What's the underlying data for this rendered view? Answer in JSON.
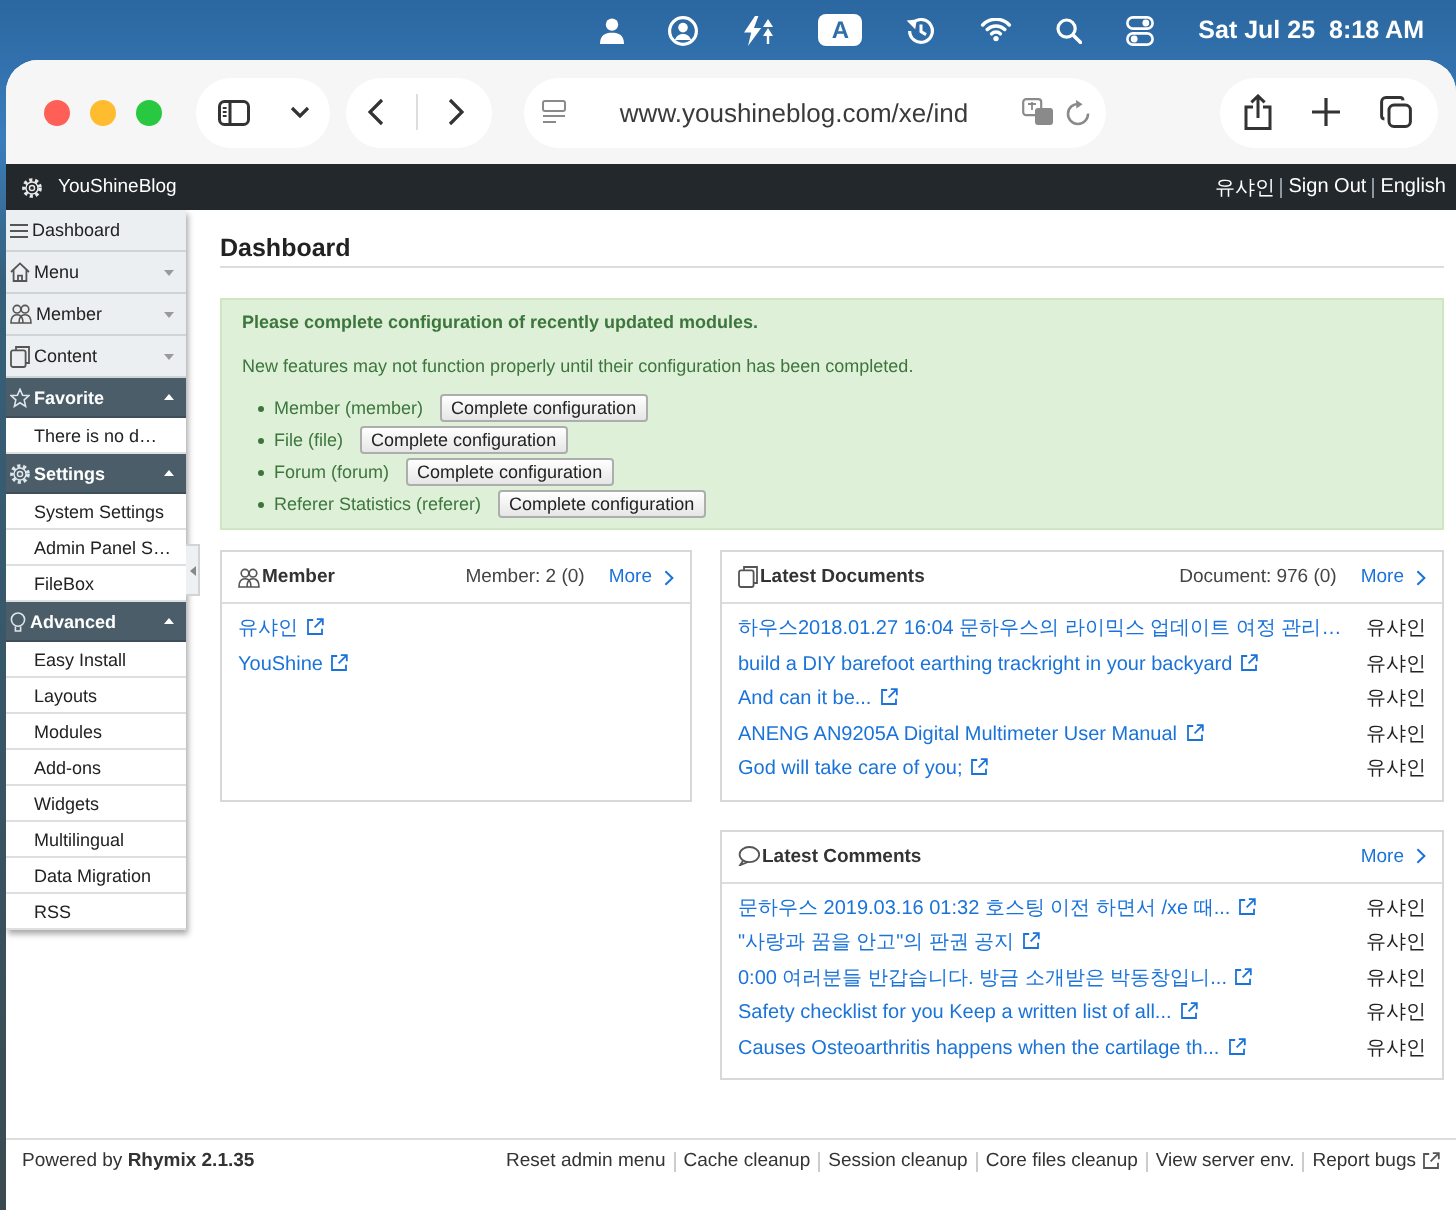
{
  "menu_bar": {
    "input_source": "A",
    "date": "Sat Jul 25",
    "time": "8:18 AM"
  },
  "browser": {
    "url": "www.youshineblog.com/xe/ind"
  },
  "site_header": {
    "title": "YouShineBlog",
    "links": [
      "유샤인",
      "Sign Out",
      "English"
    ]
  },
  "sidebar": {
    "items": [
      {
        "kind": "link",
        "label": "Dashboard"
      },
      {
        "kind": "group",
        "label": "Menu",
        "expanded": false
      },
      {
        "kind": "group",
        "label": "Member",
        "expanded": false
      },
      {
        "kind": "group",
        "label": "Content",
        "expanded": false
      },
      {
        "kind": "group",
        "label": "Favorite",
        "expanded": true,
        "children": [
          {
            "label": "There is no d…"
          }
        ]
      },
      {
        "kind": "group",
        "label": "Settings",
        "expanded": true,
        "children": [
          {
            "label": "System Settings"
          },
          {
            "label": "Admin Panel S…"
          },
          {
            "label": "FileBox"
          }
        ]
      },
      {
        "kind": "group",
        "label": "Advanced",
        "expanded": true,
        "children": [
          {
            "label": "Easy Install"
          },
          {
            "label": "Layouts"
          },
          {
            "label": "Modules"
          },
          {
            "label": "Add-ons"
          },
          {
            "label": "Widgets"
          },
          {
            "label": "Multilingual"
          },
          {
            "label": "Data Migration"
          },
          {
            "label": "RSS"
          }
        ]
      }
    ]
  },
  "page": {
    "title": "Dashboard"
  },
  "notice": {
    "title": "Please complete configuration of recently updated modules.",
    "message": "New features may not function properly until their configuration has been completed.",
    "modules": [
      {
        "name": "Member (member)",
        "button": "Complete configuration"
      },
      {
        "name": "File (file)",
        "button": "Complete configuration"
      },
      {
        "name": "Forum (forum)",
        "button": "Complete configuration"
      },
      {
        "name": "Referer Statistics (referer)",
        "button": "Complete configuration"
      }
    ]
  },
  "member_panel": {
    "title": "Member",
    "count": "Member: 2 (0)",
    "more": "More",
    "rows": [
      {
        "name": "유샤인"
      },
      {
        "name": "YouShine"
      }
    ]
  },
  "documents_panel": {
    "title": "Latest Documents",
    "count": "Document: 976 (0)",
    "more": "More",
    "rows": [
      {
        "title": "하우스2018.01.27 16:04 문하우스의 라이믹스 업데이트 여정 관리…",
        "link_icon": false,
        "author": "유샤인"
      },
      {
        "title": "build a DIY barefoot earthing trackright in your backyard",
        "link_icon": true,
        "author": "유샤인"
      },
      {
        "title": "And can it be...",
        "link_icon": true,
        "author": "유샤인"
      },
      {
        "title": "ANENG AN9205A Digital Multimeter User Manual",
        "link_icon": true,
        "author": "유샤인"
      },
      {
        "title": "God will take care of you;",
        "link_icon": true,
        "author": "유샤인"
      }
    ]
  },
  "comments_panel": {
    "title": "Latest Comments",
    "more": "More",
    "rows": [
      {
        "text": "문하우스 2019.03.16 01:32 호스팅 이전 하면서 /xe 때...",
        "author": "유샤인"
      },
      {
        "text": "\"사랑과 꿈을 안고\"의 판권 공지",
        "author": "유샤인"
      },
      {
        "text": "0:00 여러분들 반갑습니다. 방금 소개받은 박동창입니...",
        "author": "유샤인"
      },
      {
        "text": "Safety checklist for you Keep a written list of all...",
        "author": "유샤인"
      },
      {
        "text": "Causes Osteoarthritis happens when the cartilage th...",
        "author": "유샤인"
      }
    ]
  },
  "footer": {
    "powered_by": "Powered by **Rhymix 2.1.35**",
    "links": [
      {
        "label": "Reset admin menu",
        "external": false
      },
      {
        "label": "Cache cleanup",
        "external": false
      },
      {
        "label": "Session cleanup",
        "external": false
      },
      {
        "label": "Core files cleanup",
        "external": false
      },
      {
        "label": "View server env.",
        "external": false
      },
      {
        "label": "Report bugs",
        "external": true
      }
    ]
  }
}
